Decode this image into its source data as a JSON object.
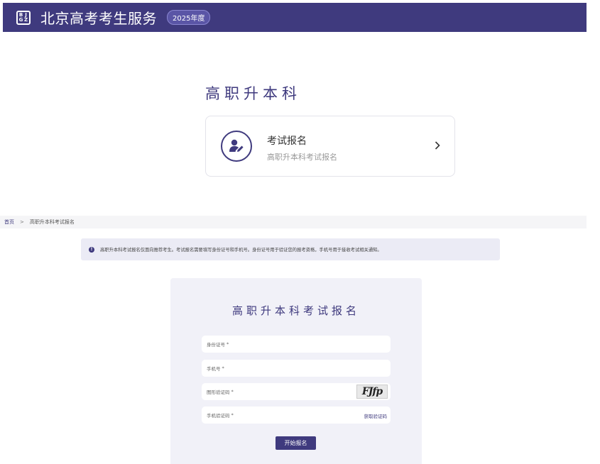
{
  "header": {
    "logo_letters": [
      "B",
      "J",
      "G",
      "Z"
    ],
    "title": "北京高考考生服务",
    "year_badge": "2025年度"
  },
  "section": {
    "title": "高职升本科"
  },
  "card": {
    "title": "考试报名",
    "subtitle": "高职升本科考试报名",
    "icon": "user-edit-icon"
  },
  "breadcrumb": {
    "home": "首页",
    "separator": ">",
    "current": "高职升本科考试报名"
  },
  "notice": {
    "icon": "info-icon",
    "text": "高职升本科考试报名仅面向推荐考生。考试报名需要填写身份证号和手机号。身份证号用于验证您的报考资格，手机号用于接收考试相关通知。"
  },
  "form": {
    "title": "高职升本科考试报名",
    "id_placeholder": "身份证号",
    "phone_placeholder": "手机号",
    "captcha_placeholder": "图形验证码",
    "captcha_text": "FJfp",
    "sms_placeholder": "手机验证码",
    "required_mark": "*",
    "get_code_label": "获取验证码",
    "submit_label": "开始报名"
  },
  "colors": {
    "primary": "#3f3a7e",
    "panel_bg": "#f1f1f8"
  }
}
